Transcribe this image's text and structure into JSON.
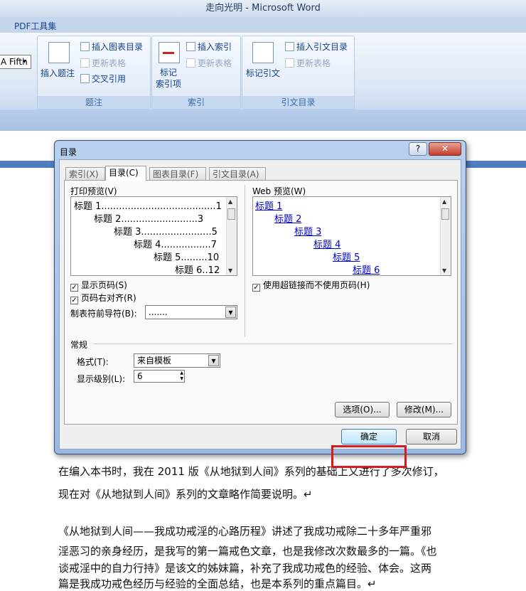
{
  "window": {
    "title": "走向光明 - Microsoft Word"
  },
  "ribbon": {
    "tab_pdf": "PDF工具集",
    "style_combo": "A Fifth",
    "caption_group": {
      "label": "题注",
      "insert_caption": "插入题注",
      "insert_table_of_figures": "插入图表目录",
      "update_table": "更新表格",
      "cross_reference": "交叉引用"
    },
    "index_group": {
      "label": "索引",
      "mark_entry": "标记\n索引项",
      "insert_index": "插入索引",
      "update_table": "更新表格"
    },
    "citation_group": {
      "label": "引文目录",
      "mark_citation": "标记引文",
      "insert_table_of_authorities": "插入引文目录",
      "update_table": "更新表格"
    }
  },
  "dialog": {
    "title": "目录",
    "help": "?",
    "close": "✕",
    "tabs": [
      {
        "label": "索引(X)",
        "active": false
      },
      {
        "label": "目录(C)",
        "active": true
      },
      {
        "label": "图表目录(F)",
        "active": false
      },
      {
        "label": "引文目录(A)",
        "active": false
      }
    ],
    "print_preview": {
      "label": "打印预览(V)",
      "lines": [
        {
          "text": "标题 1.......................................1"
        },
        {
          "text": "标题 2..........................3"
        },
        {
          "text": "标题 3........................5"
        },
        {
          "text": "标题 4.................7"
        },
        {
          "text": "标题 5.........10"
        },
        {
          "text": "标题 6..12"
        }
      ]
    },
    "web_preview": {
      "label": "Web 预览(W)",
      "lines": [
        "标题 1",
        "标题 2",
        "标题 3",
        "标题 4",
        "标题 5",
        "标题 6"
      ]
    },
    "show_page_numbers": {
      "label": "显示页码(S)",
      "checked": true
    },
    "right_align": {
      "label": "页码右对齐(R)",
      "checked": true
    },
    "tab_leader": {
      "label": "制表符前导符(B):",
      "value": "......."
    },
    "use_hyperlinks": {
      "label": "使用超链接而不使用页码(H)",
      "checked": true
    },
    "general": {
      "label": "常规"
    },
    "format": {
      "label": "格式(T):",
      "value": "来自模板"
    },
    "levels": {
      "label": "显示级别(L):",
      "value": "6"
    },
    "options_button": "选项(O)...",
    "modify_button": "修改(M)...",
    "ok_button": "确定",
    "cancel_button": "取消",
    "highlight_color": "#d71a21"
  },
  "document": {
    "paragraphs": [
      "在编入本书时，我在 2011 版《从地狱到人间》系列的基础上又进行了多次修订，",
      "现在对《从地狱到人间》系列的文章略作简要说明。↵",
      "《从地狱到人间——我成功戒淫的心路历程》讲述了我成功戒除二十多年严重邪",
      "淫恶习的亲身经历，是我写的第一篇戒色文章，也是我修改次数最多的一篇。《也",
      "谈戒淫中的自力行持》是该文的姊妹篇，补充了我成功戒色的经验、体会。这两",
      "篇是我成功戒色经历与经验的全面总结，也是本系列的重点篇目。↵"
    ]
  }
}
